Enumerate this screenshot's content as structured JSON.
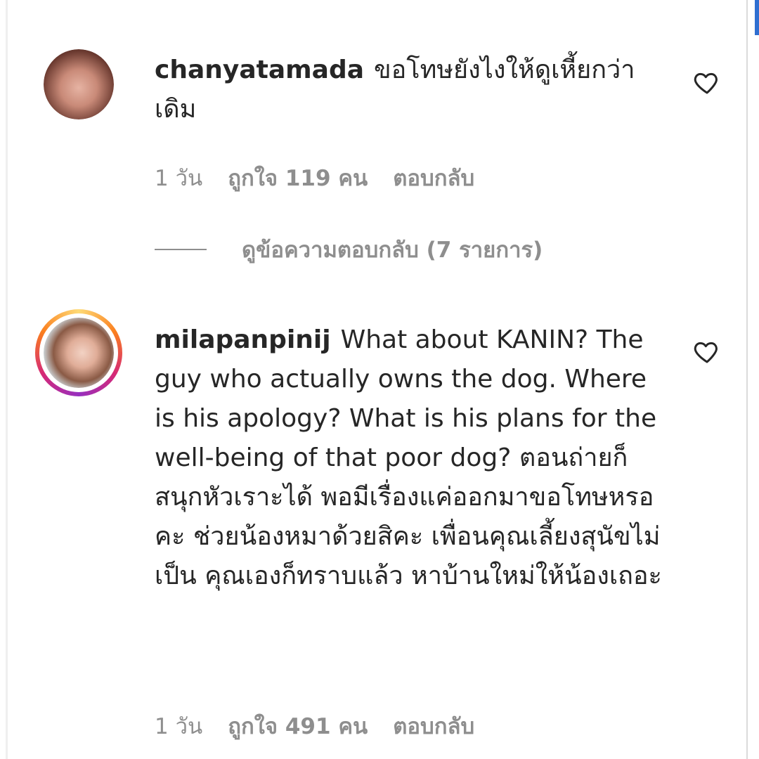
{
  "comments": [
    {
      "username": "chanyatamada",
      "text": "ขอโทษยังไงให้ดูเหี้ยกว่าเดิม",
      "time": "1 วัน",
      "likes": "ถูกใจ 119 คน",
      "reply_label": "ตอบกลับ",
      "has_story_ring": false
    },
    {
      "username": "milapanpinij",
      "text": "What about KANIN? The guy who actually owns the dog. Where is his apology? What is his plans for the well-being of that poor dog? ตอนถ่ายก็สนุกหัวเราะได้ พอมีเรื่องแค่ออกมาขอโทษหรอคะ ช่วยน้องหมาด้วยสิคะ เพื่อนคุณเลี้ยงสุนัขไม่เป็น คุณเองก็ทราบแล้ว หาบ้านใหม่ให้น้องเถอะ",
      "time": "1 วัน",
      "likes": "ถูกใจ 491 คน",
      "reply_label": "ตอบกลับ",
      "has_story_ring": true
    }
  ],
  "view_replies": "ดูข้อความตอบกลับ (7 รายการ)",
  "icons": {
    "like": "heart-outline-icon"
  },
  "colors": {
    "text": "#262626",
    "secondary": "#8e8e8e"
  }
}
